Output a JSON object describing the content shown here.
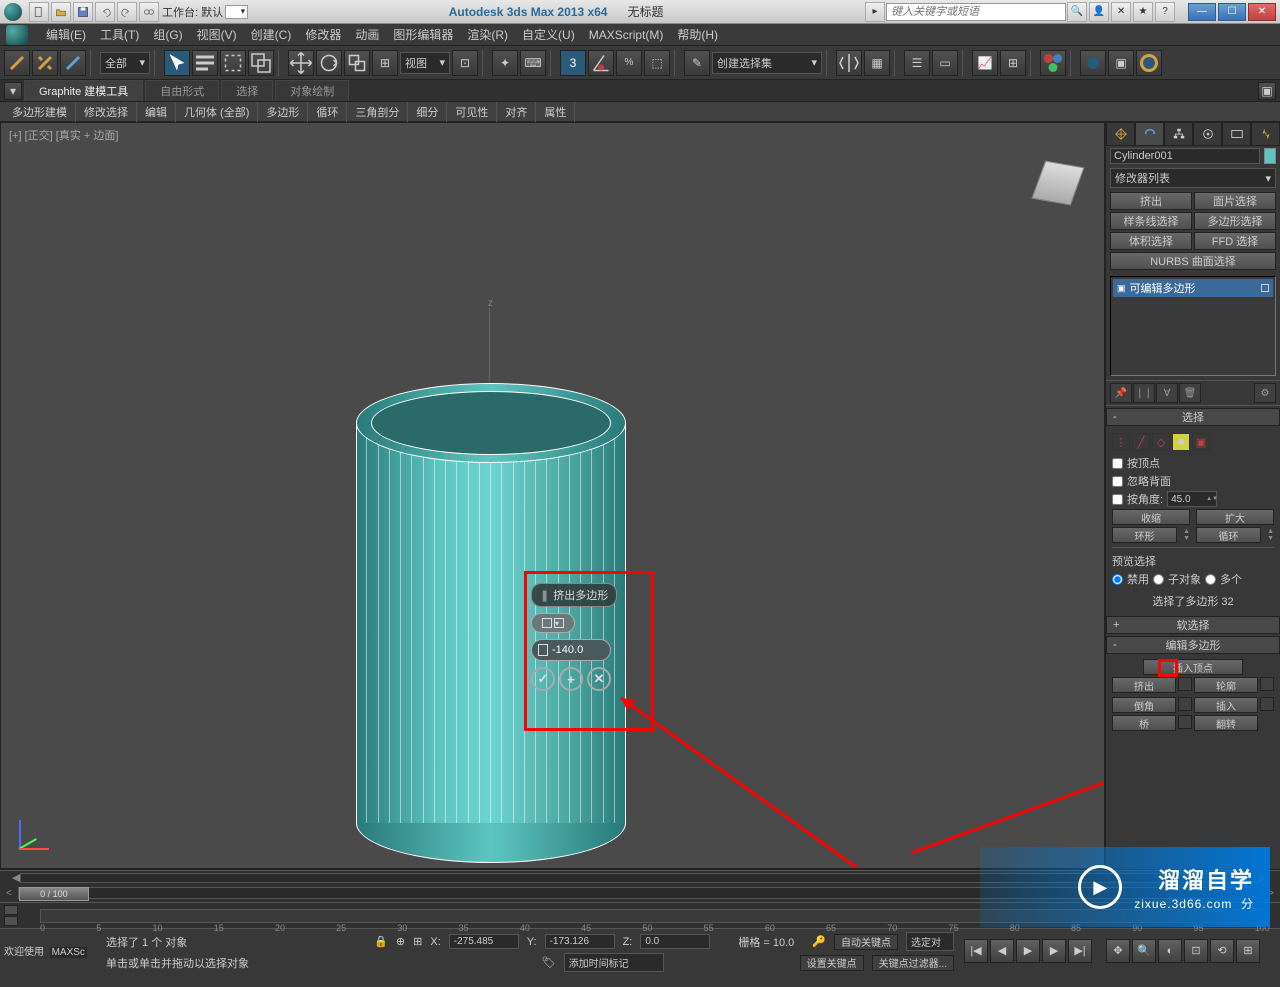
{
  "titlebar": {
    "workspace_label": "工作台: 默认",
    "app_title": "Autodesk 3ds Max  2013 x64",
    "doc_title": "无标题",
    "search_placeholder": "键入关键字或短语"
  },
  "menu": {
    "edit": "编辑(E)",
    "tools": "工具(T)",
    "group": "组(G)",
    "views": "视图(V)",
    "create": "创建(C)",
    "modifiers": "修改器",
    "animation": "动画",
    "graph": "图形编辑器",
    "render": "渲染(R)",
    "custom": "自定义(U)",
    "maxscript": "MAXScript(M)",
    "help": "帮助(H)"
  },
  "toolbar": {
    "filter_all": "全部",
    "view_label": "视图",
    "named_sel": "创建选择集"
  },
  "ribbon": {
    "tab_graphite": "Graphite 建模工具",
    "tab_freeform": "自由形式",
    "tab_select": "选择",
    "tab_objpaint": "对象绘制",
    "sub_polymod": "多边形建模",
    "sub_modsel": "修改选择",
    "sub_edit": "编辑",
    "sub_geom": "几何体 (全部)",
    "sub_poly": "多边形",
    "sub_loop": "循环",
    "sub_tri": "三角剖分",
    "sub_subdiv": "细分",
    "sub_vis": "可见性",
    "sub_align": "对齐",
    "sub_prop": "属性"
  },
  "viewport": {
    "label": "[+] [正交] [真实 + 边面]",
    "axis_z": "z"
  },
  "caddy": {
    "title": "挤出多边形",
    "value": "-140.0",
    "ok": "✓",
    "plus": "+",
    "cancel": "✕"
  },
  "cmdpanel": {
    "obj_name": "Cylinder001",
    "mod_list": "修改器列表",
    "btn_extrude": "挤出",
    "btn_facesel": "面片选择",
    "btn_splinesel": "样条线选择",
    "btn_polysel": "多边形选择",
    "btn_volsel": "体积选择",
    "btn_ffd": "FFD 选择",
    "btn_nurbs": "NURBS 曲面选择",
    "stack_item": "可编辑多边形"
  },
  "rollout_sel": {
    "title": "选择",
    "by_vertex": "按顶点",
    "ignore_back": "忽略背面",
    "by_angle": "按角度:",
    "angle_val": "45.0",
    "shrink": "收缩",
    "grow": "扩大",
    "ring": "环形",
    "loop": "循环",
    "preview_label": "预览选择",
    "preview_off": "禁用",
    "preview_sub": "子对象",
    "preview_multi": "多个",
    "status": "选择了多边形 32"
  },
  "rollout_soft": {
    "title": "软选择"
  },
  "rollout_editpoly": {
    "title": "编辑多边形",
    "insert_vert": "插入顶点",
    "extrude": "挤出",
    "outline": "轮廓",
    "bevel": "倒角",
    "inset": "插入",
    "bridge": "桥",
    "flip": "翻转"
  },
  "timeline": {
    "frame": "0 / 100",
    "ticks": [
      "0",
      "5",
      "10",
      "15",
      "20",
      "25",
      "30",
      "35",
      "40",
      "45",
      "50",
      "55",
      "60",
      "65",
      "70",
      "75",
      "80",
      "85",
      "90",
      "95",
      "100"
    ]
  },
  "status": {
    "welcome": "欢迎使用",
    "maxsc": "MAXSc",
    "sel_msg": "选择了 1 个 对象",
    "hint": "单击或单击并拖动以选择对象",
    "x_label": "X:",
    "x_val": "-275.485",
    "y_label": "Y:",
    "y_val": "-173.126",
    "z_label": "Z:",
    "z_val": "0.0",
    "grid": "栅格 = 10.0",
    "autokey": "自动关键点",
    "selkey": "选定对",
    "setkey": "设置关键点",
    "keyfilter": "关键点过滤器...",
    "addtag": "添加时间标记"
  },
  "watermark": {
    "brand": "溜溜自学",
    "url": "zixue.3d66.com",
    "tail": "分"
  }
}
